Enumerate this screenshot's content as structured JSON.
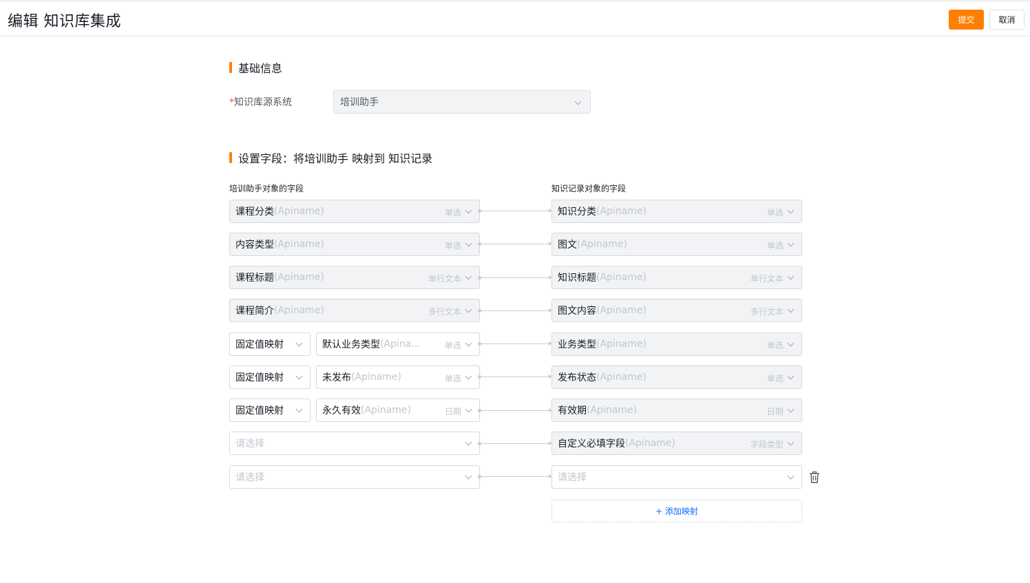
{
  "header": {
    "title": "编辑 知识库集成",
    "submit_label": "提交",
    "cancel_label": "取消"
  },
  "basic_section": {
    "title": "基础信息",
    "source_label_required": "*",
    "source_label": "知识库源系统",
    "source_value": "培训助手"
  },
  "mapping_section": {
    "title": "设置字段：将培训助手 映射到 知识记录",
    "left_column_header": "培训助手对象的字段",
    "right_column_header": "知识记录对象的字段",
    "rows": [
      {
        "left": {
          "name": "课程分类",
          "api": "(Apiname)",
          "type": "单选"
        },
        "right": {
          "name": "知识分类",
          "api": "(Apiname)",
          "type": "单选"
        }
      },
      {
        "left": {
          "name": "内容类型",
          "api": "(Apiname)",
          "type": "单选"
        },
        "right": {
          "name": "图文",
          "api": "(Apiname)",
          "type": "单选"
        }
      },
      {
        "left": {
          "name": "课程标题",
          "api": "(Apiname)",
          "type": "单行文本"
        },
        "right": {
          "name": "知识标题",
          "api": "(Apiname)",
          "type": "单行文本"
        }
      },
      {
        "left": {
          "name": "课程简介",
          "api": "(Apiname)",
          "type": "多行文本"
        },
        "right": {
          "name": "图文内容",
          "api": "(Apiname)",
          "type": "多行文本"
        }
      },
      {
        "left_mode": "固定值映射",
        "left": {
          "name": "默认业务类型",
          "api": "(Apina...",
          "type": "单选"
        },
        "right": {
          "name": "业务类型",
          "api": "(Apiname)",
          "type": "单选"
        }
      },
      {
        "left_mode": "固定值映射",
        "left": {
          "name": "未发布",
          "api": "(Apiname)",
          "type": "单选"
        },
        "right": {
          "name": "发布状态",
          "api": "(Apiname)",
          "type": "单选"
        }
      },
      {
        "left_mode": "固定值映射",
        "left": {
          "name": "永久有效",
          "api": "(Apiname)",
          "type": "日期"
        },
        "right": {
          "name": "有效期",
          "api": "(Apiname)",
          "type": "日期"
        }
      },
      {
        "left_placeholder": "请选择",
        "right": {
          "name": "自定义必填字段",
          "api": "(Apiname)",
          "type": "字段类型"
        }
      },
      {
        "left_placeholder": "请选择",
        "right_placeholder": "请选择"
      }
    ],
    "add_mapping_label": "+ 添加映射"
  },
  "colors": {
    "accent": "#ff8000",
    "link": "#0c6cff",
    "required": "#ff522a"
  }
}
